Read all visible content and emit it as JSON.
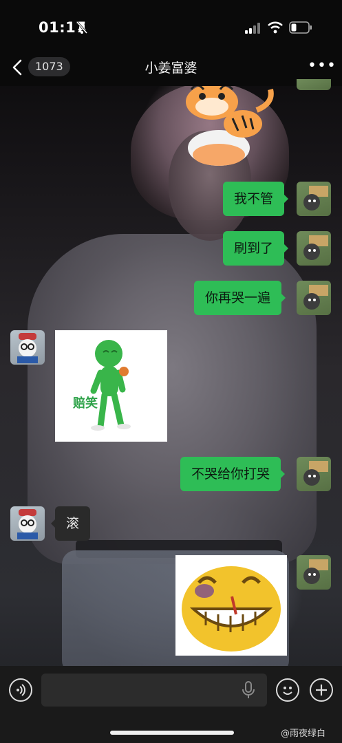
{
  "status_bar": {
    "time": "01:17"
  },
  "nav": {
    "unread_count": "1073",
    "title": "小姜富婆"
  },
  "messages": [
    {
      "side": "self",
      "type": "text",
      "text": "我不管"
    },
    {
      "side": "self",
      "type": "text",
      "text": "刷到了"
    },
    {
      "side": "self",
      "type": "text",
      "text": "你再哭一遍"
    },
    {
      "side": "other",
      "type": "sticker",
      "caption": "赔笑"
    },
    {
      "side": "self",
      "type": "text",
      "text": "不哭给你打哭"
    },
    {
      "side": "other",
      "type": "text",
      "text": "滚"
    },
    {
      "side": "self",
      "type": "sticker",
      "caption": ""
    }
  ],
  "input": {
    "placeholder": ""
  },
  "watermark": "@雨夜绿白",
  "colors": {
    "bubble_self": "#2ebd56",
    "bubble_other": "#2a2a2a",
    "background": "#0a0a0a"
  },
  "icons": [
    "back-chevron-icon",
    "more-icon",
    "voice-icon",
    "mic-icon",
    "emoji-icon",
    "plus-icon",
    "bell-slash-icon",
    "signal-icon",
    "wifi-icon",
    "battery-icon"
  ]
}
